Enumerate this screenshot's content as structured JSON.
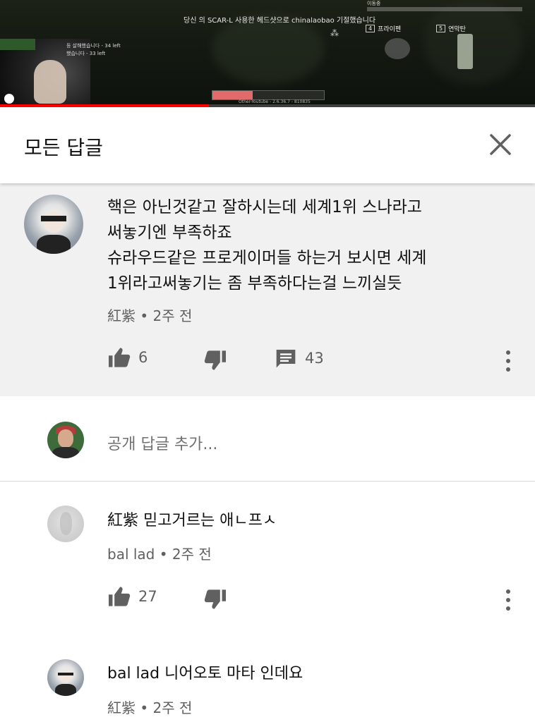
{
  "video": {
    "kill_feed": "당신 의 SCAR-L 사용한 헤드샷으로 chinalaobao 기절했습니다",
    "hud_label": "이동중",
    "slot1": {
      "num": "4",
      "label": "프라이펜"
    },
    "slot2": {
      "num": "5",
      "label": "연막탄"
    },
    "feed_left_1": "등 살해했습니다 - 34 left",
    "feed_left_2": "했습니다 - 33 left",
    "version": "Other-Youtube - 2.6.36.7 - 810835",
    "progress": 0.39,
    "health": 0.36
  },
  "header": {
    "title": "모든 답글",
    "close_icon": "close-icon"
  },
  "top_comment": {
    "text_lines": [
      "핵은 아닌것같고 잘하시는데 세계1위 스나라고",
      "써놓기엔 부족하죠",
      "슈라우드같은 프로게이머들 하는거 보시면 세계",
      "1위라고써놓기는 좀 부족하다는걸 느끼실듯"
    ],
    "author": "紅紫",
    "time": "2주 전",
    "likes": "6",
    "replies": "43"
  },
  "add_reply": {
    "placeholder": "공개 답글 추가..."
  },
  "replies": [
    {
      "text": "紅紫 믿고거르는 애ㄴ프ㅅ",
      "author": "bal lad",
      "time": "2주 전",
      "likes": "27"
    },
    {
      "text": "bal lad 니어오토 마타 인데요",
      "author": "紅紫",
      "time": "2주 전"
    }
  ],
  "colors": {
    "accent_red": "#ff0000",
    "meta_grey": "#606060",
    "top_comment_bg": "#f1f1f1"
  }
}
